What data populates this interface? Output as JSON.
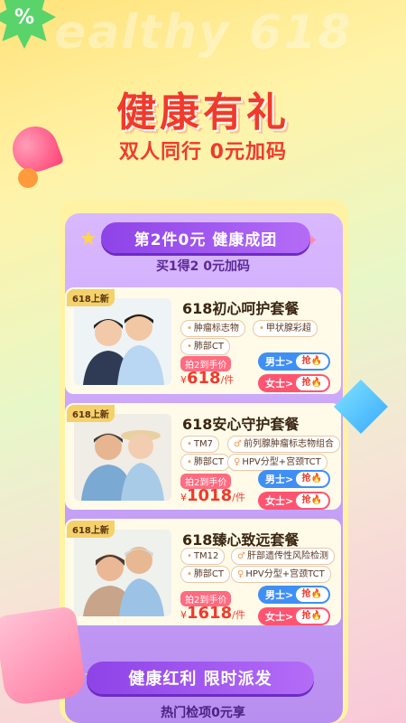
{
  "header": {
    "bg_word": "ealthy 618",
    "badge_symbol": "%",
    "title": "健康有礼",
    "subtitle": "双人同行 0元加码"
  },
  "promo": {
    "ribbon": "第2件0元  健康成团",
    "sub": "买1得2  0元加码"
  },
  "cards": [
    {
      "tag": "618上新",
      "title": "618初心呵护套餐",
      "chips": [
        "肿瘤标志物",
        "甲状腺彩超",
        "肺部CT"
      ],
      "price_label": "拍2到手价",
      "price_symbol": "¥",
      "price": "618",
      "price_unit": "/件",
      "male_label": "男士>",
      "female_label": "女士>",
      "grab": "抢🔥"
    },
    {
      "tag": "618上新",
      "title": "618安心守护套餐",
      "chips": [
        "TM7",
        "前列腺肿瘤标志物组合",
        "肺部CT",
        "HPV分型+宫颈TCT"
      ],
      "price_label": "拍2到手价",
      "price_symbol": "¥",
      "price": "1018",
      "price_unit": "/件",
      "male_label": "男士>",
      "female_label": "女士>",
      "grab": "抢🔥"
    },
    {
      "tag": "618上新",
      "title": "618臻心致远套餐",
      "chips": [
        "TM12",
        "肝部遗传性风险检测",
        "肺部CT",
        "HPV分型+宫颈TCT"
      ],
      "price_label": "拍2到手价",
      "price_symbol": "¥",
      "price": "1618",
      "price_unit": "/件",
      "male_label": "男士>",
      "female_label": "女士>",
      "grab": "抢🔥"
    }
  ],
  "bottom": {
    "ribbon": "健康红利  限时派发",
    "sub": "热门检项0元享"
  },
  "colors": {
    "accent_red": "#f03a2d",
    "male_blue": "#3f8ff5",
    "female_pink": "#ff5470",
    "purple": "#8e43e8"
  }
}
